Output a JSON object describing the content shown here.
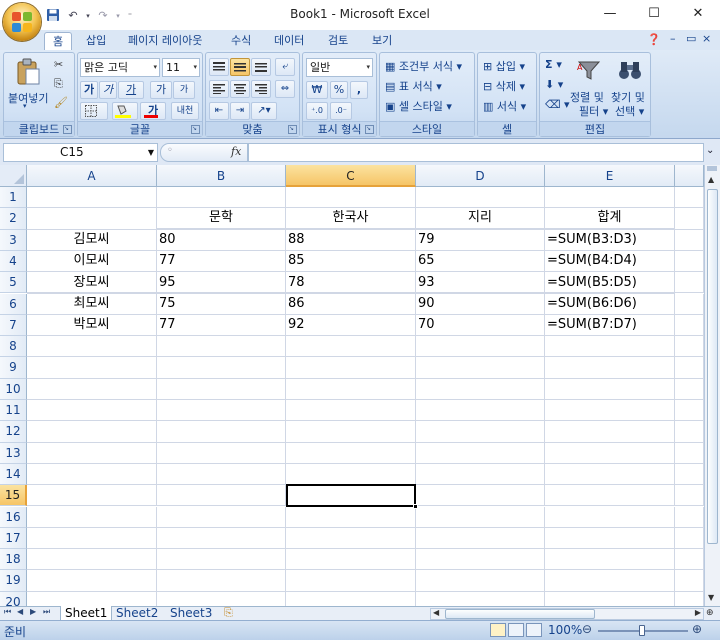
{
  "window": {
    "title": "Book1 - Microsoft Excel",
    "minimize": "—",
    "maximize": "☐",
    "close": "✕"
  },
  "tabs": [
    "홈",
    "삽입",
    "페이지 레이아웃",
    "수식",
    "데이터",
    "검토",
    "보기"
  ],
  "active_tab": "홈",
  "ribbon": {
    "clipboard": {
      "label": "클립보드",
      "paste": "붙여넣기"
    },
    "font": {
      "label": "글꼴",
      "font_name": "맑은 고딕",
      "font_size": "11",
      "bold": "가",
      "italic": "가",
      "underline": "가",
      "grow": "가",
      "shrink": "가",
      "phonetic": "내천"
    },
    "alignment": {
      "label": "맞춤"
    },
    "number": {
      "label": "표시 형식",
      "format": "일반",
      "currency": "₩",
      "percent": "%",
      "comma": ","
    },
    "styles": {
      "label": "스타일",
      "conditional": "조건부 서식",
      "table": "표 서식",
      "cell": "셀 스타일"
    },
    "cells": {
      "label": "셀",
      "insert": "삽입",
      "delete": "삭제",
      "format": "서식"
    },
    "editing": {
      "label": "편집",
      "sort": "정렬 및",
      "sort2": "필터",
      "find": "찾기 및",
      "find2": "선택"
    }
  },
  "formula_bar": {
    "name_box": "C15",
    "fx": "fx",
    "formula": ""
  },
  "columns": [
    "A",
    "B",
    "C",
    "D",
    "E"
  ],
  "selected_column": "C",
  "rows": [
    "1",
    "2",
    "3",
    "4",
    "5",
    "6",
    "7",
    "8",
    "9",
    "10",
    "11",
    "12",
    "13",
    "14",
    "15",
    "16",
    "17",
    "18",
    "19",
    "20"
  ],
  "selected_row": "15",
  "cells": {
    "B2": "문학",
    "C2": "한국사",
    "D2": "지리",
    "E2": "합계",
    "A3": "김모씨",
    "B3": "80",
    "C3": "88",
    "D3": "79",
    "E3": "=SUM(B3:D3)",
    "A4": "이모씨",
    "B4": "77",
    "C4": "85",
    "D4": "65",
    "E4": "=SUM(B4:D4)",
    "A5": "장모씨",
    "B5": "95",
    "C5": "78",
    "D5": "93",
    "E5": "=SUM(B5:D5)",
    "A6": "최모씨",
    "B6": "75",
    "C6": "86",
    "D6": "90",
    "E6": "=SUM(B6:D6)",
    "A7": "박모씨",
    "B7": "77",
    "C7": "92",
    "D7": "70",
    "E7": "=SUM(B7:D7)"
  },
  "sheets": [
    "Sheet1",
    "Sheet2",
    "Sheet3"
  ],
  "active_sheet": "Sheet1",
  "status": {
    "mode": "준비",
    "zoom": "100%",
    "zoom_out": "⊖",
    "zoom_in": "⊕"
  },
  "colors": {
    "accent": "#15428b",
    "selection_header": "#f6c567",
    "ribbon": "#d2e2f5"
  }
}
